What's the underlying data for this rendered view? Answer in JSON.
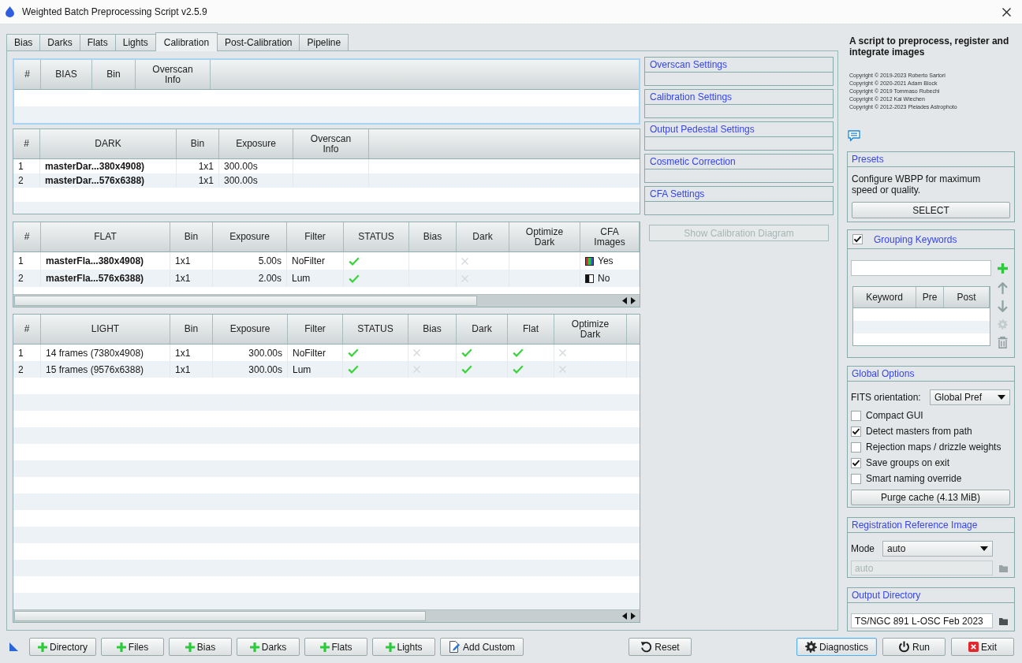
{
  "window": {
    "title": "Weighted Batch Preprocessing Script v2.5.9"
  },
  "tabs": [
    {
      "label": "Bias",
      "selected": false
    },
    {
      "label": "Darks",
      "selected": false
    },
    {
      "label": "Flats",
      "selected": false
    },
    {
      "label": "Lights",
      "selected": false
    },
    {
      "label": "Calibration",
      "selected": true
    },
    {
      "label": "Post-Calibration",
      "selected": false
    },
    {
      "label": "Pipeline",
      "selected": false
    }
  ],
  "bias_table": {
    "focused": true,
    "columns": [
      "#",
      "BIAS",
      "Bin",
      "Overscan Info"
    ]
  },
  "dark_table": {
    "focused": false,
    "columns": [
      "#",
      "DARK",
      "Bin",
      "Exposure",
      "Overscan Info"
    ],
    "rows": [
      {
        "index": "1",
        "name": "masterDar...380x4908)",
        "bin": "1x1",
        "exposure": "300.00s"
      },
      {
        "index": "2",
        "name": "masterDar...576x6388)",
        "bin": "1x1",
        "exposure": "300.00s"
      }
    ]
  },
  "flat_table": {
    "focused": false,
    "columns": [
      "#",
      "FLAT",
      "Bin",
      "Exposure",
      "Filter",
      "STATUS",
      "Bias",
      "Dark",
      "Optimize Dark",
      "CFA Images"
    ],
    "rows": [
      {
        "index": "1",
        "name": "masterFla...380x4908)",
        "bin": "1x1",
        "exposure": "5.00s",
        "filter": "NoFilter",
        "status": true,
        "dark": false,
        "cfa_images": true,
        "cfa_label": "Yes"
      },
      {
        "index": "2",
        "name": "masterFla...576x6388)",
        "bin": "1x1",
        "exposure": "2.00s",
        "filter": "Lum",
        "status": true,
        "dark": false,
        "cfa_images": false,
        "cfa_label": "No"
      }
    ]
  },
  "light_table": {
    "focused": false,
    "columns": [
      "#",
      "LIGHT",
      "Bin",
      "Exposure",
      "Filter",
      "STATUS",
      "Bias",
      "Dark",
      "Flat",
      "Optimize Dark"
    ],
    "rows": [
      {
        "index": "1",
        "name": "14 frames (7380x4908)",
        "bin": "1x1",
        "exposure": "300.00s",
        "filter": "NoFilter",
        "status": true,
        "bias": false,
        "dark": true,
        "flat": true,
        "optimize_dark": false
      },
      {
        "index": "2",
        "name": "15 frames (9576x6388)",
        "bin": "1x1",
        "exposure": "300.00s",
        "filter": "Lum",
        "status": true,
        "bias": false,
        "dark": true,
        "flat": true,
        "optimize_dark": false
      }
    ]
  },
  "calibration_sections": [
    {
      "title": "Overscan Settings"
    },
    {
      "title": "Calibration Settings"
    },
    {
      "title": "Output Pedestal Settings"
    },
    {
      "title": "Cosmetic Correction"
    },
    {
      "title": "CFA Settings"
    }
  ],
  "diagram_button": {
    "label": "Show Calibration Diagram",
    "disabled": true
  },
  "about": {
    "description": "A script to preprocess, register and integrate images",
    "copyright": [
      "Copyright © 2019-2023 Roberto Sartori",
      "Copyright © 2020-2021 Adam Block",
      "Copyright © 2019 Tommaso Rubechi",
      "Copyright © 2012 Kai Wiechen",
      "Copyright © 2012-2023 Pleiades Astrophoto"
    ]
  },
  "presets": {
    "title": "Presets",
    "text": "Configure WBPP for maximum speed or quality.",
    "button": "SELECT"
  },
  "grouping_keywords": {
    "title": "Grouping Keywords",
    "checked": true,
    "columns": [
      "Keyword",
      "Pre",
      "Post"
    ]
  },
  "global_options": {
    "title": "Global Options",
    "fits_orientation": {
      "label": "FITS orientation:",
      "value": "Global Pref"
    },
    "options": [
      {
        "label": "Compact GUI",
        "checked": false
      },
      {
        "label": "Detect masters from path",
        "checked": true
      },
      {
        "label": "Rejection maps / drizzle weights",
        "checked": false
      },
      {
        "label": "Save groups on exit",
        "checked": true
      },
      {
        "label": "Smart naming override",
        "checked": false
      }
    ],
    "button": "Purge cache (4.13 MiB)"
  },
  "registration_reference": {
    "title": "Registration Reference Image",
    "mode": {
      "label": "Mode",
      "value": "auto"
    },
    "path": {
      "value": "auto",
      "disabled": true
    }
  },
  "output_directory": {
    "title": "Output Directory",
    "value": "TS/NGC 891 L-OSC Feb 2023"
  },
  "bottom_bar": {
    "add_buttons": [
      {
        "kind": "add",
        "label": "Directory",
        "focused": false
      },
      {
        "kind": "add",
        "label": "Files",
        "focused": false
      },
      {
        "kind": "add",
        "label": "Bias",
        "focused": false
      },
      {
        "kind": "add",
        "label": "Darks",
        "focused": false
      },
      {
        "kind": "add",
        "label": "Flats",
        "focused": false
      },
      {
        "kind": "add",
        "label": "Lights",
        "focused": false
      },
      {
        "kind": "custom",
        "label": "Add Custom",
        "focused": false
      }
    ],
    "reset_button": {
      "kind": "reset",
      "label": "Reset",
      "focused": false
    },
    "action_buttons": [
      {
        "kind": "diagnostics",
        "label": "Diagnostics",
        "focused": true
      },
      {
        "kind": "run",
        "label": "Run",
        "focused": false
      },
      {
        "kind": "exit",
        "label": "Exit",
        "focused": false
      }
    ]
  }
}
